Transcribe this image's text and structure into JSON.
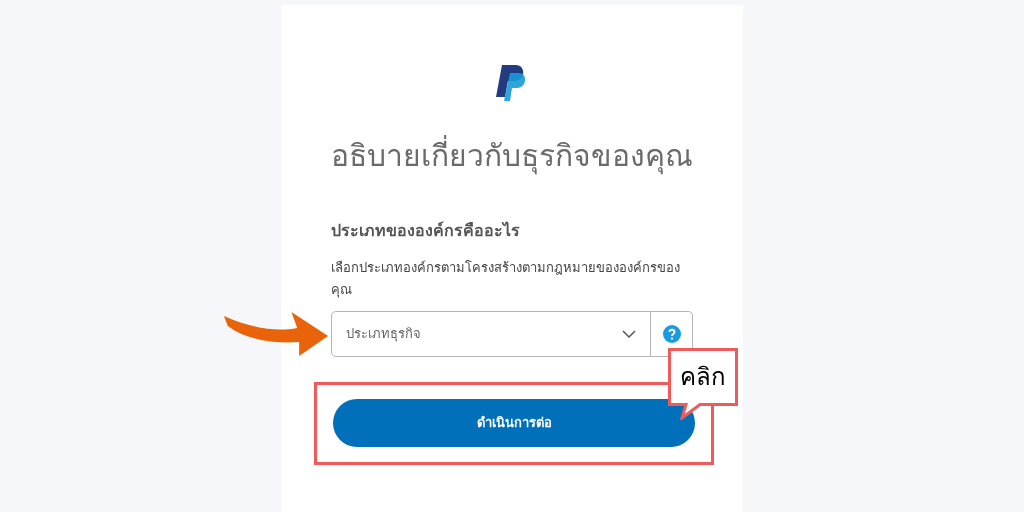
{
  "title": "อธิบายเกี่ยวกับธุรกิจของคุณ",
  "question": "ประเภทขององค์กรคืออะไร",
  "description": "เลือกประเภทองค์กรตามโครงสร้างตามกฎหมายขององค์กรของคุณ",
  "select": {
    "placeholder": "ประเภทธุรกิจ"
  },
  "continue_button": "ดำเนินการต่อ",
  "callout": "คลิก"
}
